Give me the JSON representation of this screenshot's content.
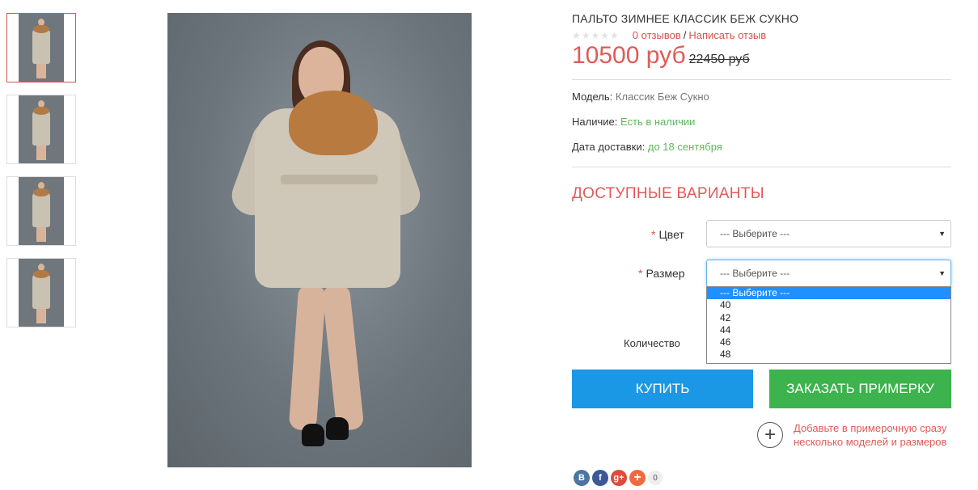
{
  "product": {
    "title": "ПАЛЬТО ЗИМНЕЕ КЛАССИК БЕЖ СУКНО",
    "rating_stars": 0,
    "reviews_link": "0 отзывов",
    "write_review_link": "Написать отзыв",
    "separator": "/",
    "price": "10500 руб",
    "old_price": "22450 руб"
  },
  "details": {
    "model_label": "Модель:",
    "model_value": "Классик Беж Сукно",
    "stock_label": "Наличие:",
    "stock_value": "Есть в наличии",
    "delivery_label": "Дата доставки:",
    "delivery_value": "до 18 сентября"
  },
  "variants": {
    "title": "ДОСТУПНЫЕ ВАРИАНТЫ",
    "required_mark": "*",
    "color_label": "Цвет",
    "color_value": "--- Выберите ---",
    "size_label": "Размер",
    "size_value": "--- Выберите ---",
    "size_options": [
      "--- Выберите ---",
      "40",
      "42",
      "44",
      "46",
      "48"
    ],
    "size_selected_index": 0,
    "quantity_label": "Количество"
  },
  "actions": {
    "buy": "КУПИТЬ",
    "order_fitting": "ЗАКАЗАТЬ ПРИМЕРКУ",
    "fitting_note": "Добавьте в примерочную сразу несколько моделей и размеров"
  },
  "social": {
    "vk": "B",
    "fb": "f",
    "gplus": "g+",
    "share_count": "0"
  },
  "colors": {
    "accent_red": "#e05a57",
    "buy_blue": "#1a98e6",
    "fit_green": "#3cb34c",
    "in_stock_green": "#5cb85c"
  },
  "thumbnails_count": 4
}
